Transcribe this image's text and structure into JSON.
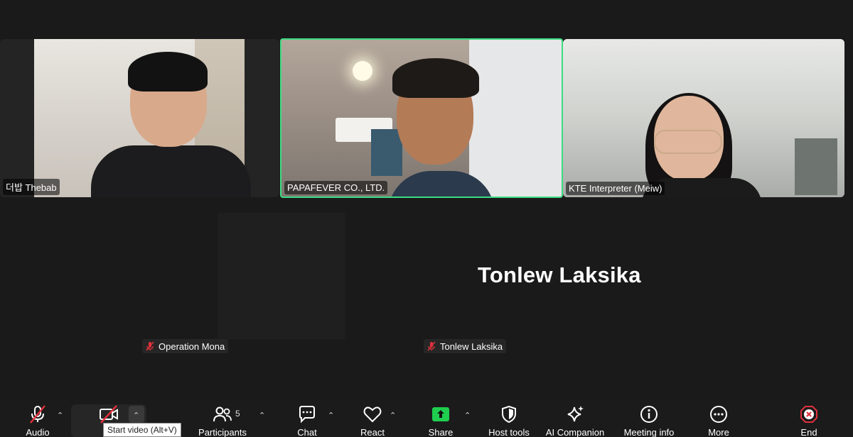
{
  "participants": {
    "tile1_name": "더밥 Thebab",
    "tile2_name": "PAPAFEVER CO., LTD.",
    "tile3_name": "KTE Interpreter (Meiw)",
    "muted1_name": "Operation Mona",
    "muted2_name": "Tonlew Laksika",
    "active_no_video_name": "Tonlew Laksika"
  },
  "toolbar": {
    "audio_label": "Audio",
    "video_label": "V",
    "participants_label": "Participants",
    "participants_count": "5",
    "chat_label": "Chat",
    "react_label": "React",
    "share_label": "Share",
    "host_tools_label": "Host tools",
    "ai_companion_label": "AI Companion",
    "meeting_info_label": "Meeting info",
    "more_label": "More",
    "end_label": "End"
  },
  "tooltip": "Start video (Alt+V)",
  "colors": {
    "active_speaker_border": "#3ddc84",
    "share_green": "#1fce4f",
    "muted_red": "#e0313b",
    "end_red": "#e0313b"
  }
}
